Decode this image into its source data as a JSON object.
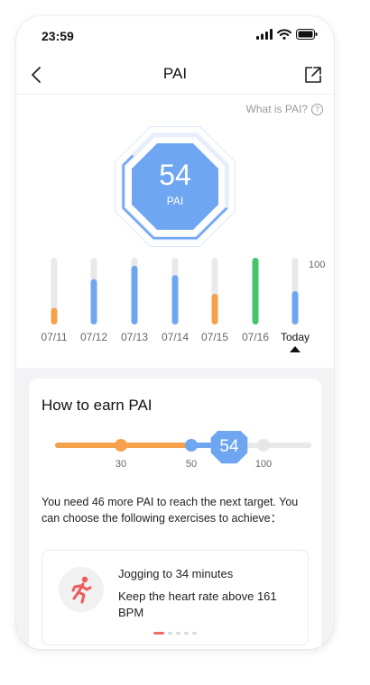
{
  "status_bar": {
    "time": "23:59"
  },
  "header": {
    "title": "PAI"
  },
  "help_link": {
    "label": "What is PAI?",
    "icon": "question-circle-icon"
  },
  "pai": {
    "value": "54",
    "label": "PAI",
    "progress_fraction": 0.54
  },
  "colors": {
    "blue": "#6fa6f2",
    "orange": "#f5a04a",
    "green": "#43c56e",
    "track": "#e9e9e9"
  },
  "weekly_chart": {
    "max_label": "100",
    "days": [
      {
        "label": "07/11",
        "value": 25,
        "color": "orange"
      },
      {
        "label": "07/12",
        "value": 68,
        "color": "blue"
      },
      {
        "label": "07/13",
        "value": 88,
        "color": "blue"
      },
      {
        "label": "07/14",
        "value": 74,
        "color": "blue"
      },
      {
        "label": "07/15",
        "value": 46,
        "color": "orange"
      },
      {
        "label": "07/16",
        "value": 100,
        "color": "green"
      },
      {
        "label": "Today",
        "value": 50,
        "color": "blue"
      }
    ]
  },
  "earn": {
    "title": "How to earn PAI",
    "current": "54",
    "milestones": [
      "30",
      "50",
      "100"
    ],
    "description": "You need 46 more PAI to reach the next target. You can choose the following exercises to achieve：",
    "exercise": {
      "icon": "running-person-icon",
      "line1": "Jogging to 34 minutes",
      "line2": "Keep the heart rate above 161 BPM"
    },
    "pager_count": 5,
    "pager_active": 0
  }
}
